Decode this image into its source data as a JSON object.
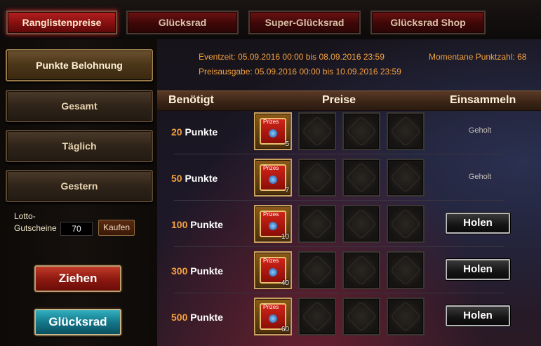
{
  "tabs": [
    {
      "label": "Ranglistenpreise",
      "active": true
    },
    {
      "label": "Glücksrad",
      "active": false
    },
    {
      "label": "Super-Glücksrad",
      "active": false
    },
    {
      "label": "Glücksrad Shop",
      "active": false
    }
  ],
  "sidebar": {
    "items": [
      {
        "label": "Punkte Belohnung",
        "active": true
      },
      {
        "label": "Gesamt",
        "active": false
      },
      {
        "label": "Täglich",
        "active": false
      },
      {
        "label": "Gestern",
        "active": false
      }
    ],
    "lotto_label": "Lotto-Gutscheine",
    "lotto_value": "70",
    "kaufen_label": "Kaufen",
    "ziehen_label": "Ziehen",
    "gluecksrad_label": "Glücksrad"
  },
  "event": {
    "eventzeit": "Eventzeit: 05.09.2016 00:00 bis 08.09.2016 23:59",
    "preisausgabe": "Preisausgabe: 05.09.2016 00:00 bis 10.09.2016 23:59",
    "punktzahl": "Momentane Punktzahl:  68"
  },
  "table": {
    "headers": {
      "needed": "Benötigt",
      "prizes": "Preise",
      "collect": "Einsammeln"
    },
    "rows": [
      {
        "points": "20",
        "unit": " Punkte",
        "prize_label": "Prizes",
        "qty": "5",
        "status": "Geholt",
        "button": ""
      },
      {
        "points": "50",
        "unit": " Punkte",
        "prize_label": "Prizes",
        "qty": "7",
        "status": "Geholt",
        "button": ""
      },
      {
        "points": "100",
        "unit": " Punkte",
        "prize_label": "Prizes",
        "qty": "10",
        "status": "",
        "button": "Holen"
      },
      {
        "points": "300",
        "unit": " Punkte",
        "prize_label": "Prizes",
        "qty": "40",
        "status": "",
        "button": "Holen"
      },
      {
        "points": "500",
        "unit": " Punkte",
        "prize_label": "Prizes",
        "qty": "60",
        "status": "",
        "button": "Holen"
      }
    ]
  },
  "colors": {
    "accent_orange": "#f4a040",
    "tab_red": "#8a1010",
    "panel_gold": "#4a3518"
  }
}
